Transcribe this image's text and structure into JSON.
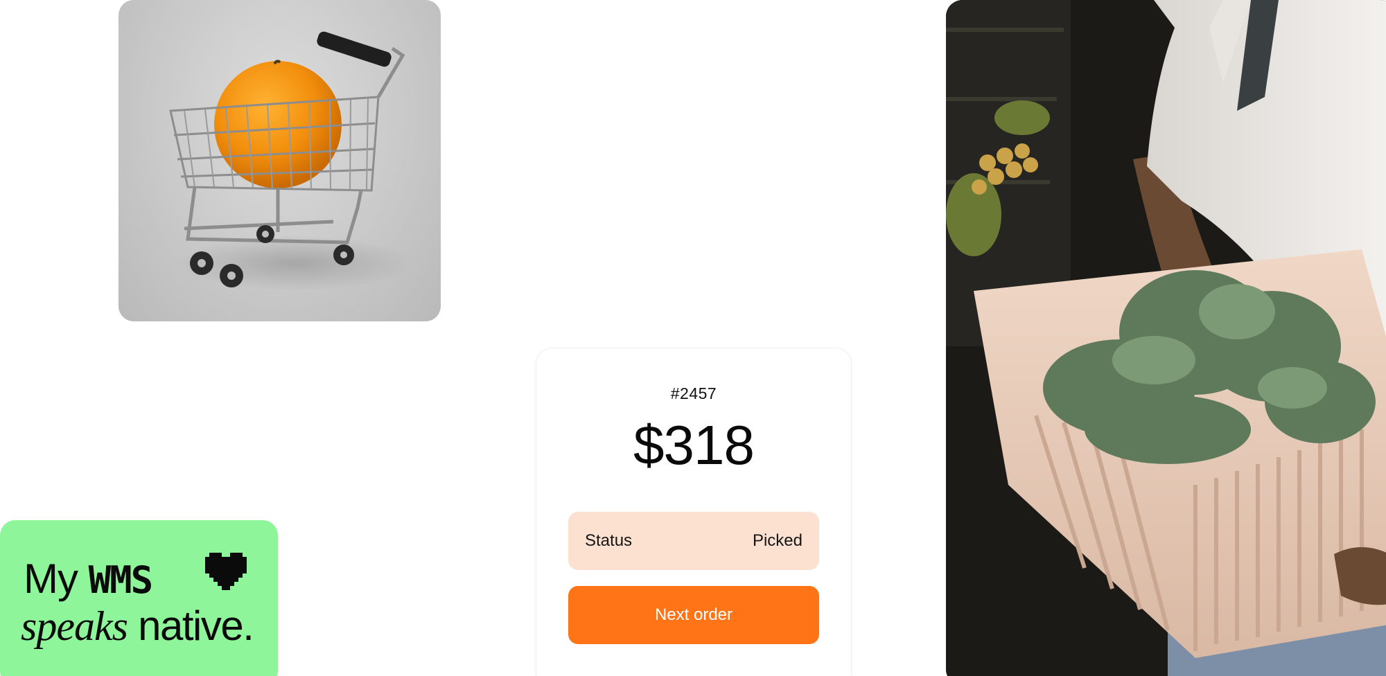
{
  "order": {
    "number": "#2457",
    "amount": "$318",
    "status_label": "Status",
    "status_value": "Picked",
    "next_button_label": "Next order"
  },
  "tagline": {
    "line1_prefix": "My",
    "line1_brand": "WMS",
    "line2_italic": "speaks",
    "line2_rest": "native."
  },
  "images": {
    "cart_photo": "shopping-cart-with-orange",
    "worker_photo": "worker-carrying-crate-of-greens"
  },
  "colors": {
    "accent_orange": "#ff7417",
    "status_bg": "#fce1d1",
    "tagline_bg": "#8ff59a"
  }
}
